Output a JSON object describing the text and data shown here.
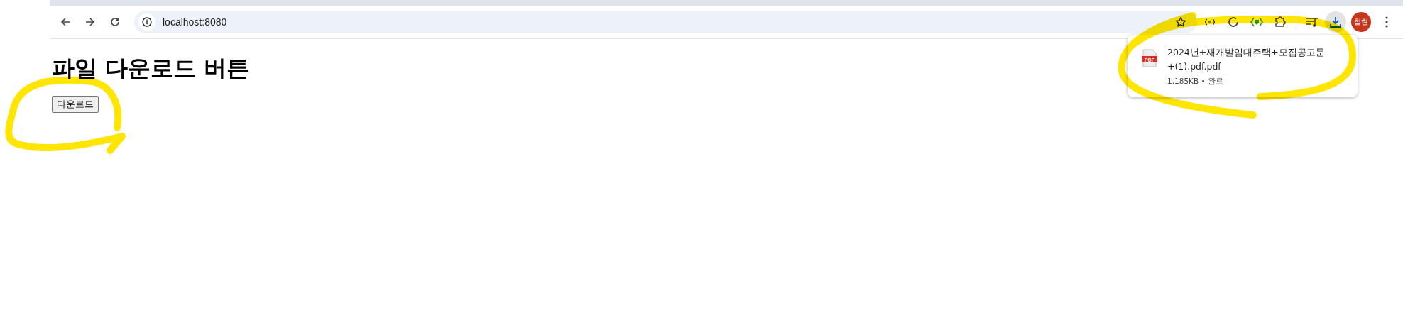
{
  "toolbar": {
    "address": "localhost:8080",
    "profile_initials": "철현"
  },
  "page": {
    "heading": "파일 다운로드 버튼",
    "button": "다운로드"
  },
  "download_popup": {
    "file_type": "PDF",
    "file_name": "2024년+재개발임대주택+모집공고문+(1).pdf.pdf",
    "details": "1,185KB • 완료"
  }
}
